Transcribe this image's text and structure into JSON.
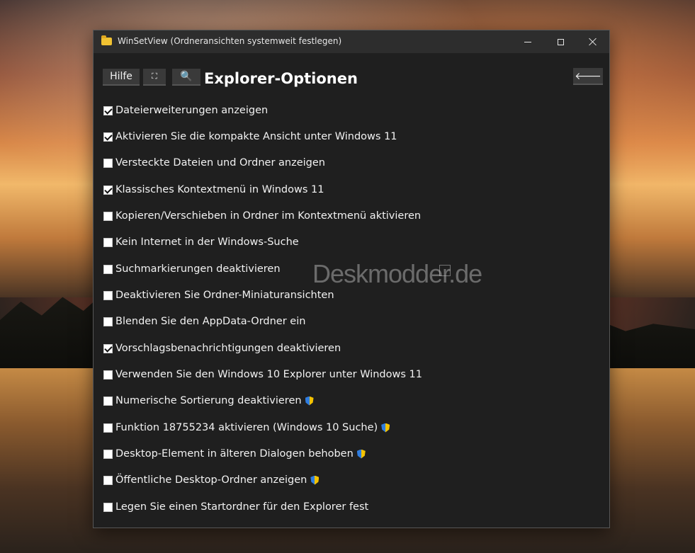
{
  "window": {
    "title": "WinSetView (Ordneransichten systemweit festlegen)"
  },
  "toolbar": {
    "help_label": "Hilfe",
    "fullscreen_glyph": "⛶",
    "search_glyph": "🔍",
    "back_glyph": "🡐"
  },
  "page": {
    "title": "Explorer-Optionen"
  },
  "options": [
    {
      "label": "Dateierweiterungen anzeigen",
      "checked": true,
      "admin": false
    },
    {
      "label": "Aktivieren Sie die kompakte Ansicht unter Windows 11",
      "checked": true,
      "admin": false
    },
    {
      "label": "Versteckte Dateien und Ordner anzeigen",
      "checked": false,
      "admin": false
    },
    {
      "label": "Klassisches Kontextmenü in Windows 11",
      "checked": true,
      "admin": false
    },
    {
      "label": "Kopieren/Verschieben in Ordner im Kontextmenü aktivieren",
      "checked": false,
      "admin": false
    },
    {
      "label": "Kein Internet in der Windows-Suche",
      "checked": false,
      "admin": false
    },
    {
      "label": "Suchmarkierungen deaktivieren",
      "checked": false,
      "admin": false
    },
    {
      "label": "Deaktivieren Sie Ordner-Miniaturansichten",
      "checked": false,
      "admin": false
    },
    {
      "label": "Blenden Sie den AppData-Ordner ein",
      "checked": false,
      "admin": false
    },
    {
      "label": "Vorschlagsbenachrichtigungen deaktivieren",
      "checked": true,
      "admin": false
    },
    {
      "label": "Verwenden Sie den Windows 10 Explorer unter Windows 11",
      "checked": false,
      "admin": false
    },
    {
      "label": "Numerische Sortierung deaktivieren",
      "checked": false,
      "admin": true
    },
    {
      "label": "Funktion 18755234 aktivieren (Windows 10 Suche)",
      "checked": false,
      "admin": true
    },
    {
      "label": "Desktop-Element in älteren Dialogen behoben",
      "checked": false,
      "admin": true
    },
    {
      "label": "Öffentliche Desktop-Ordner anzeigen",
      "checked": false,
      "admin": true
    },
    {
      "label": "Legen Sie einen Startordner für den Explorer fest",
      "checked": false,
      "admin": false
    }
  ],
  "watermark": {
    "text": "Deskmodder.de"
  },
  "icons": {
    "app": "folder-icon",
    "admin": "uac-shield-icon"
  }
}
